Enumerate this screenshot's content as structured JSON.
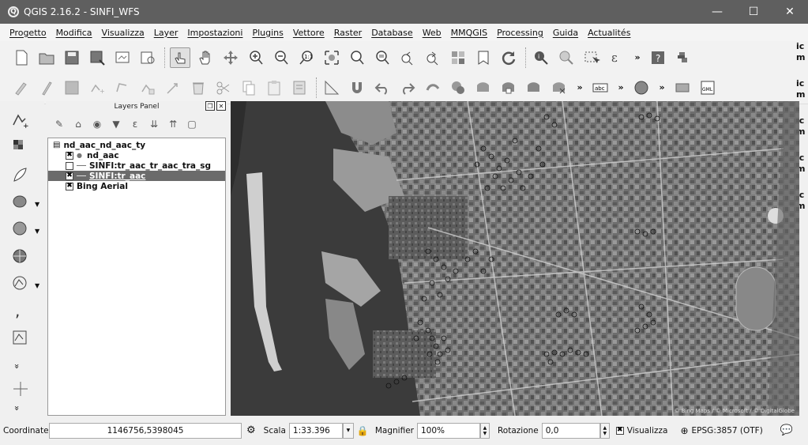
{
  "window": {
    "title": "QGIS 2.16.2 - SINFI_WFS",
    "app_glyph": "Q",
    "btn_minimize": "—",
    "btn_maximize": "☐",
    "btn_close": "✕"
  },
  "menu": [
    "Progetto",
    "Modifica",
    "Visualizza",
    "Layer",
    "Impostazioni",
    "Plugins",
    "Vettore",
    "Raster",
    "Database",
    "Web",
    "MMQGIS",
    "Processing",
    "Guida",
    "Actualités"
  ],
  "toolbar_overflow": "»",
  "right_edge_text": [
    "ic m",
    "ic m",
    "ic m",
    "ic m",
    "ic m",
    "ic m"
  ],
  "layers_panel": {
    "title": "Layers Panel",
    "layers": [
      {
        "name": "nd_aac_nd_aac_ty",
        "checked": false,
        "level": 0,
        "symbol": "table"
      },
      {
        "name": "nd_aac",
        "checked": true,
        "level": 1,
        "symbol": "point"
      },
      {
        "name": "SINFI:tr_aac_tr_aac_tra_sg",
        "checked": false,
        "level": 1,
        "symbol": "line"
      },
      {
        "name": "SINFI:tr_aac",
        "checked": true,
        "level": 1,
        "symbol": "line",
        "selected": true
      },
      {
        "name": "Bing Aerial",
        "checked": true,
        "level": 0,
        "symbol": "none"
      }
    ]
  },
  "left_tools_more": "»",
  "statusbar": {
    "coord_label": "Coordinate",
    "coord_value": "1146756,5398045",
    "scale_label": "Scala",
    "scale_value": "1:33.396",
    "magnifier_label": "Magnifier",
    "magnifier_value": "100%",
    "rotation_label": "Rotazione",
    "rotation_value": "0,0",
    "render_label": "Visualizza",
    "render_checked": true,
    "crs": "EPSG:3857 (OTF)"
  },
  "map": {
    "attribution": "© Bing Maps / © Microsoft / © DigitalGlobe"
  },
  "colors": {
    "titlebar": "#5f5f5f",
    "selected_row": "#6b6b6b",
    "sea": "#3b3b3b"
  }
}
